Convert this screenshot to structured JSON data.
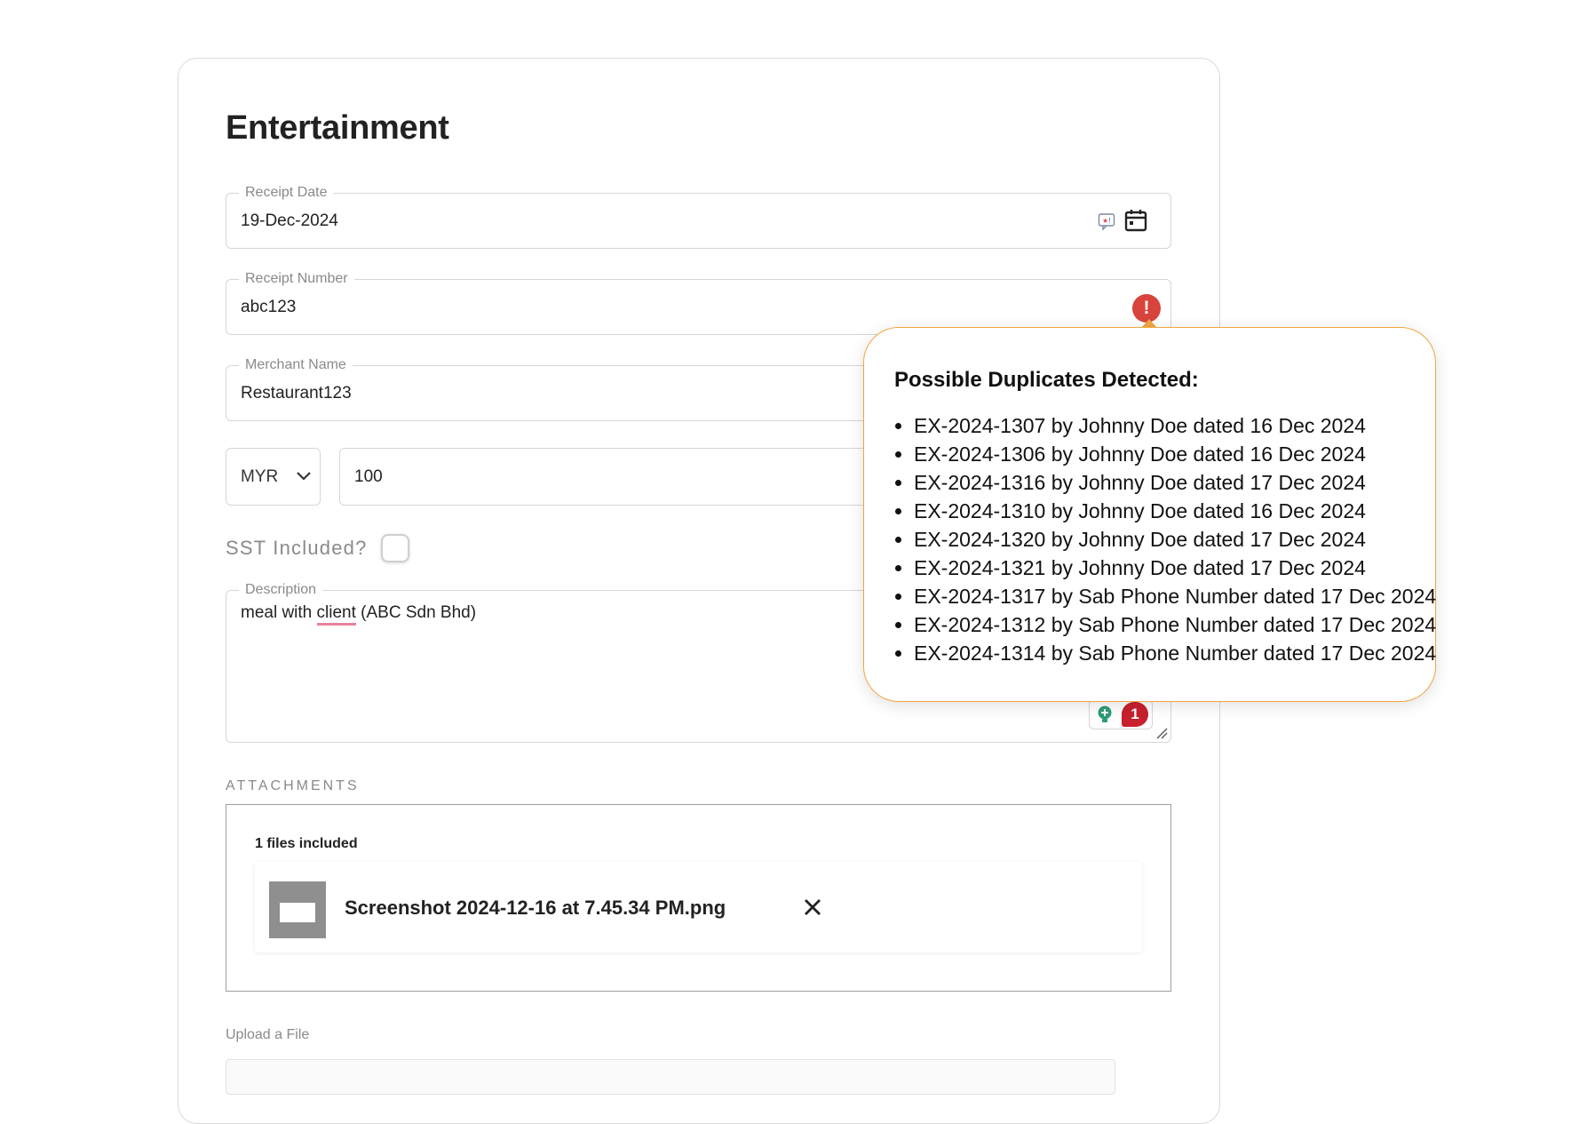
{
  "page": {
    "title": "Entertainment"
  },
  "fields": {
    "receipt_date": {
      "label": "Receipt Date",
      "value": "19-Dec-2024"
    },
    "receipt_number": {
      "label": "Receipt Number",
      "value": "abc123",
      "error_glyph": "!"
    },
    "merchant_name": {
      "label": "Merchant Name",
      "value": "Restaurant123"
    },
    "currency": {
      "selected": "MYR"
    },
    "amount": {
      "value": "100"
    },
    "sst": {
      "label": "SST Included?",
      "checked": false
    },
    "description": {
      "label": "Description",
      "value_before": "meal with ",
      "value_flagged": "client",
      "value_after": " (ABC Sdn Bhd)",
      "grammar_issue_count": "1"
    }
  },
  "attachments": {
    "heading": "ATTACHMENTS",
    "count_label": "1 files included",
    "files": [
      {
        "name": "Screenshot 2024-12-16 at 7.45.34 PM.png"
      }
    ]
  },
  "upload": {
    "label": "Upload a File"
  },
  "duplicates_popover": {
    "title": "Possible Duplicates Detected:",
    "items": [
      "EX-2024-1307 by Johnny Doe dated 16 Dec 2024",
      "EX-2024-1306 by Johnny Doe dated 16 Dec 2024",
      "EX-2024-1316 by Johnny Doe dated 17 Dec 2024",
      "EX-2024-1310 by Johnny Doe dated 16 Dec 2024",
      "EX-2024-1320 by Johnny Doe dated 17 Dec 2024",
      "EX-2024-1321 by Johnny Doe dated 17 Dec 2024",
      "EX-2024-1317 by Sab Phone Number dated 17 Dec 2024",
      "EX-2024-1312 by Sab Phone Number dated 17 Dec 2024",
      "EX-2024-1314 by Sab Phone Number dated 17 Dec 2024"
    ]
  },
  "icons": {
    "autofill": "autofill-icon",
    "calendar": "calendar-icon",
    "error": "error-icon",
    "chevron": "chevron-down-icon",
    "grammar": "grammar-bulb-icon",
    "close": "close-icon",
    "resize": "resize-handle-icon"
  },
  "colors": {
    "error": "#d8443b",
    "popover_border": "#f0a640",
    "spell_underline": "#e8819a",
    "grammar_badge": "#c8202e"
  }
}
